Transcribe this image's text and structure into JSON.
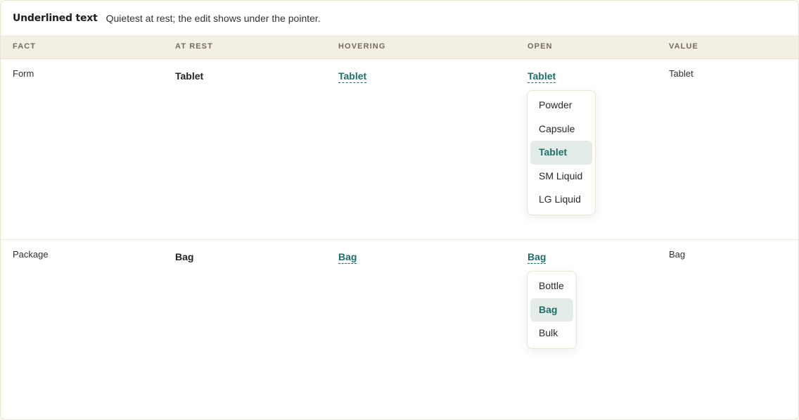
{
  "header": {
    "title": "Underlined text",
    "subtitle": "Quietest at rest; the edit shows under the pointer."
  },
  "columns": {
    "fact": "FACT",
    "at_rest": "AT REST",
    "hovering": "HOVERING",
    "open": "OPEN",
    "value": "VALUE"
  },
  "rows": [
    {
      "fact": "Form",
      "at_rest": "Tablet",
      "hovering": "Tablet",
      "open": "Tablet",
      "value": "Tablet",
      "options": [
        "Powder",
        "Capsule",
        "Tablet",
        "SM Liquid",
        "LG Liquid"
      ],
      "selected": "Tablet"
    },
    {
      "fact": "Package",
      "at_rest": "Bag",
      "hovering": "Bag",
      "open": "Bag",
      "value": "Bag",
      "options": [
        "Bottle",
        "Bag",
        "Bulk"
      ],
      "selected": "Bag"
    }
  ],
  "colors": {
    "accent": "#1e6f6a",
    "header_band": "#f3efe4",
    "selected_bg": "#e3ece8",
    "border": "#ece4d2"
  }
}
